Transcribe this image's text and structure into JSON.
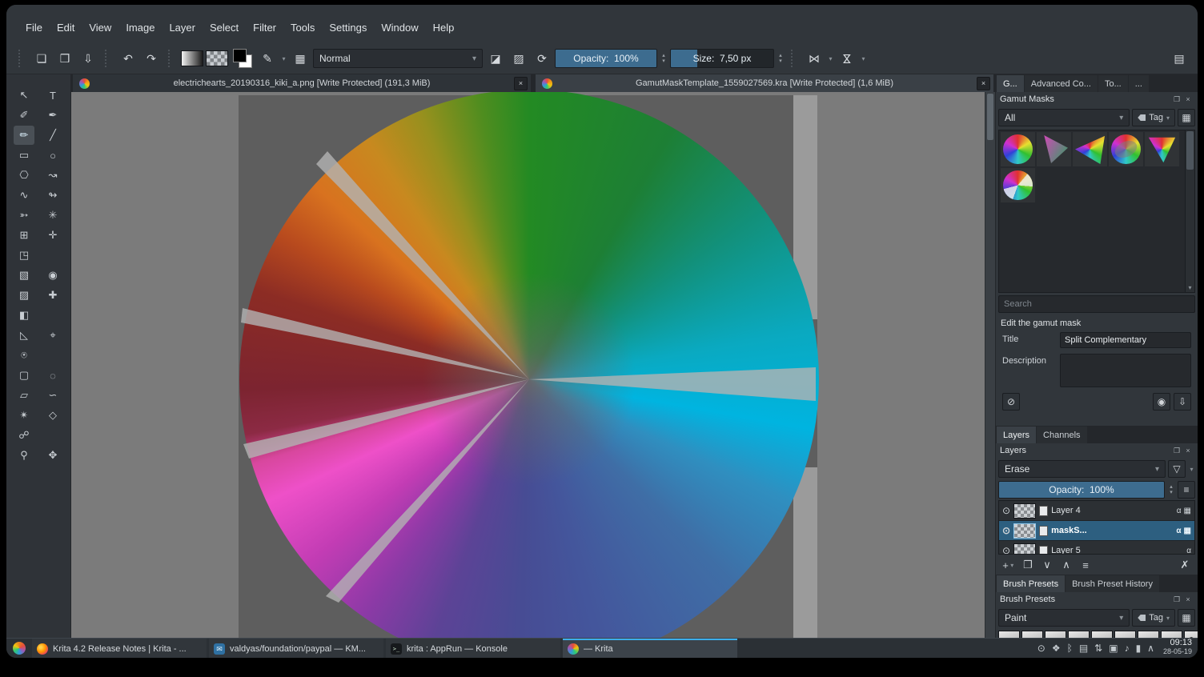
{
  "theme": {
    "accent": "#3daee9",
    "slider_fill": "#3d6c8f",
    "selection_blue": "#2d5f80",
    "window_bg": "#31363b",
    "canvas_bg": "#7b7b7b",
    "document_bg": "#5e5e5e"
  },
  "glyphs": {
    "caret_down": "▾",
    "caret_up": "▴",
    "float": "❐",
    "close": "×",
    "eye": "⊙",
    "preview": "◉",
    "save_mask": "⇩",
    "cancel": "⊘",
    "funnel": "▽",
    "add": "+",
    "duplicate": "❐",
    "arrow_up": "∧",
    "arrow_down": "∨",
    "properties": "≡",
    "delete": "✗",
    "grid": "▦",
    "scroll_down": "▾",
    "handle_dots": "⋯"
  },
  "menu": {
    "items": [
      "File",
      "Edit",
      "View",
      "Image",
      "Layer",
      "Select",
      "Filter",
      "Tools",
      "Settings",
      "Window",
      "Help"
    ]
  },
  "toolbar": {
    "icons": {
      "new": "❏",
      "open": "❒",
      "save": "⇩",
      "undo": "↶",
      "redo": "↷",
      "brush_editor": "✎",
      "presets_grid": "▦",
      "eraser": "◪",
      "preserve_alpha": "▨",
      "reload": "⟳",
      "mirror_h": "⋈",
      "mirror_v": "⋈",
      "workspace": "▤"
    },
    "blend_mode": "Normal",
    "opacity_label": "Opacity:",
    "opacity_value": "100%",
    "size_label": "Size:",
    "size_value": "7,50 px"
  },
  "document_tabs": [
    {
      "title": "electrichearts_20190316_kiki_a.png [Write Protected]  (191,3 MiB)",
      "active": false
    },
    {
      "title": "GamutMaskTemplate_1559027569.kra [Write Protected]  (1,6 MiB)",
      "active": true
    }
  ],
  "toolbox": {
    "tools": [
      {
        "name": "select-shapes-tool",
        "glyph": "↖"
      },
      {
        "name": "text-tool",
        "glyph": "T"
      },
      {
        "name": "edit-shapes-tool",
        "glyph": "✐"
      },
      {
        "name": "calligraphy-tool",
        "glyph": "✒"
      },
      {
        "name": "freehand-brush-tool",
        "glyph": "✏",
        "selected": true
      },
      {
        "name": "line-tool",
        "glyph": "╱"
      },
      {
        "name": "rectangle-tool",
        "glyph": "▭"
      },
      {
        "name": "ellipse-tool",
        "glyph": "○"
      },
      {
        "name": "polygon-tool",
        "glyph": "⎔"
      },
      {
        "name": "polyline-tool",
        "glyph": "↝"
      },
      {
        "name": "bezier-curve-tool",
        "glyph": "∿"
      },
      {
        "name": "freehand-path-tool",
        "glyph": "↬"
      },
      {
        "name": "dynamic-brush-tool",
        "glyph": "➳"
      },
      {
        "name": "multibrush-tool",
        "glyph": "✳"
      },
      {
        "name": "transform-tool",
        "glyph": "⊞"
      },
      {
        "name": "move-tool",
        "glyph": "✛"
      },
      {
        "name": "crop-tool",
        "glyph": "◳"
      },
      {
        "name": "empty-cell",
        "glyph": ""
      },
      {
        "name": "gradient-tool",
        "glyph": "▧"
      },
      {
        "name": "color-sampler-tool",
        "glyph": "◉"
      },
      {
        "name": "pattern-edit-tool",
        "glyph": "▨"
      },
      {
        "name": "smart-patch-tool",
        "glyph": "✚"
      },
      {
        "name": "fill-tool",
        "glyph": "◧"
      },
      {
        "name": "empty-cell",
        "glyph": ""
      },
      {
        "name": "assistants-tool",
        "glyph": "◺"
      },
      {
        "name": "measure-tool",
        "glyph": "⌖"
      },
      {
        "name": "reference-images-tool",
        "glyph": "⍟"
      },
      {
        "name": "empty-cell",
        "glyph": ""
      },
      {
        "name": "rectangular-select-tool",
        "glyph": "▢"
      },
      {
        "name": "elliptical-select-tool",
        "glyph": "◌"
      },
      {
        "name": "polygonal-select-tool",
        "glyph": "▱"
      },
      {
        "name": "freehand-select-tool",
        "glyph": "∽"
      },
      {
        "name": "similar-select-tool",
        "glyph": "✴"
      },
      {
        "name": "bezier-select-tool",
        "glyph": "◇"
      },
      {
        "name": "magnetic-select-tool",
        "glyph": "☍"
      },
      {
        "name": "empty-cell",
        "glyph": ""
      },
      {
        "name": "zoom-tool",
        "glyph": "⚲"
      },
      {
        "name": "pan-tool",
        "glyph": "✥"
      }
    ]
  },
  "canvas": {
    "wheel_stops": [
      {
        "angle": "0deg",
        "color": "#238a23"
      },
      {
        "angle": "30deg",
        "color": "#1d7f35"
      },
      {
        "angle": "55deg",
        "color": "#12917c"
      },
      {
        "angle": "80deg",
        "color": "#0aa9c0"
      },
      {
        "angle": "100deg",
        "color": "#00b4e0"
      },
      {
        "angle": "115deg",
        "color": "#2f8fc0"
      },
      {
        "angle": "135deg",
        "color": "#3f6ea6"
      },
      {
        "angle": "165deg",
        "color": "#44569c"
      },
      {
        "angle": "182deg",
        "color": "#474c94"
      },
      {
        "angle": "200deg",
        "color": "#5c4396"
      },
      {
        "angle": "215deg",
        "color": "#8c3aa6"
      },
      {
        "angle": "230deg",
        "color": "#c23cb4"
      },
      {
        "angle": "245deg",
        "color": "#ee50c8"
      },
      {
        "angle": "253deg",
        "color": "#d8479e"
      },
      {
        "angle": "259deg",
        "color": "#8c2a44"
      },
      {
        "angle": "268deg",
        "color": "#7c2430"
      },
      {
        "angle": "288deg",
        "color": "#8c2c24"
      },
      {
        "angle": "300deg",
        "color": "#b84a1e"
      },
      {
        "angle": "312deg",
        "color": "#d8721f"
      },
      {
        "angle": "326deg",
        "color": "#c8891f"
      },
      {
        "angle": "338deg",
        "color": "#97901e"
      },
      {
        "angle": "350deg",
        "color": "#4f8d1f"
      },
      {
        "angle": "360deg",
        "color": "#238a23"
      }
    ]
  },
  "gamut_docker": {
    "tabs": [
      {
        "label": "G...",
        "active": true
      },
      {
        "label": "Advanced Co...",
        "active": false
      },
      {
        "label": "To...",
        "active": false
      },
      {
        "label": "...",
        "active": false
      }
    ],
    "title": "Gamut Masks",
    "filter_value": "All",
    "tag_label": "Tag",
    "masks": [
      {
        "kind": "wheel"
      },
      {
        "kind": "tri-gm"
      },
      {
        "kind": "tri-rainbow"
      },
      {
        "kind": "blob"
      },
      {
        "kind": "tri-down"
      },
      {
        "kind": "wheel-mask"
      }
    ],
    "search_placeholder": "Search",
    "edit_section_label": "Edit the gamut mask",
    "title_label": "Title",
    "title_value": "Split Complementary",
    "description_label": "Description",
    "description_value": ""
  },
  "layers_docker": {
    "tabs": [
      {
        "label": "Layers",
        "active": true
      },
      {
        "label": "Channels",
        "active": false
      }
    ],
    "title": "Layers",
    "blend_mode": "Erase",
    "opacity_label": "Opacity:",
    "opacity_value": "100%",
    "layers": [
      {
        "name": "Layer 4",
        "selected": false,
        "badges": [
          "α",
          "▦"
        ]
      },
      {
        "name": "maskS...",
        "selected": true,
        "badges": [
          "α",
          "▦"
        ]
      },
      {
        "name": "Layer 5",
        "selected": false,
        "badges": [
          "α"
        ]
      }
    ]
  },
  "brush_docker": {
    "tabs": [
      {
        "label": "Brush Presets",
        "active": true
      },
      {
        "label": "Brush Preset History",
        "active": false
      }
    ],
    "title": "Brush Presets",
    "filter_value": "Paint",
    "tag_label": "Tag",
    "presets": [
      {
        "glyph": "∿"
      },
      {
        "glyph": "∿"
      },
      {
        "glyph": "∿"
      },
      {
        "glyph": "∿"
      },
      {
        "glyph": "∿"
      },
      {
        "glyph": "∿"
      },
      {
        "glyph": "∿"
      },
      {
        "glyph": "∿"
      },
      {
        "glyph": "✎"
      }
    ]
  },
  "taskbar": {
    "tasks": [
      {
        "app": "firefox",
        "icon_glyph": "",
        "title": "Krita 4.2 Release Notes | Krita - ...",
        "active": false
      },
      {
        "app": "kmail",
        "icon_glyph": "✉",
        "title": "valdyas/foundation/paypal — KM...",
        "active": false
      },
      {
        "app": "konsole",
        "icon_glyph": ">_",
        "title": "krita : AppRun — Konsole",
        "active": false
      },
      {
        "app": "krita",
        "icon_glyph": "",
        "title": "— Krita",
        "active": true
      }
    ],
    "tray": [
      {
        "name": "user-activity-icon",
        "glyph": "⊙"
      },
      {
        "name": "kdeconnect-icon",
        "glyph": "❖"
      },
      {
        "name": "bluetooth-icon",
        "glyph": "ᛒ"
      },
      {
        "name": "display-icon",
        "glyph": "▤"
      },
      {
        "name": "network-icon",
        "glyph": "⇅"
      },
      {
        "name": "clipboard-icon",
        "glyph": "▣"
      },
      {
        "name": "volume-icon",
        "glyph": "♪"
      },
      {
        "name": "battery-icon",
        "glyph": "▮"
      },
      {
        "name": "expand-arrow-icon",
        "glyph": "∧"
      }
    ],
    "clock_time": "09:13",
    "clock_date": "28-05-19"
  }
}
